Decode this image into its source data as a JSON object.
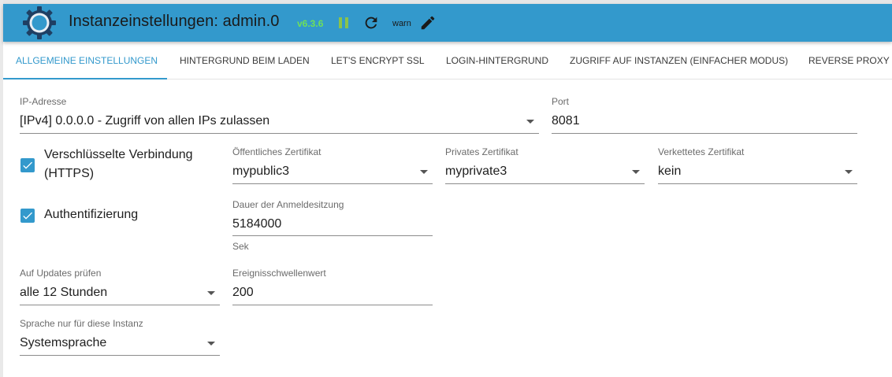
{
  "header": {
    "title": "Instanzeinstellungen: admin.0",
    "version": "v6.3.6",
    "loglevel": "warn"
  },
  "tabs": [
    {
      "label": "Allgemeine Einstellungen"
    },
    {
      "label": "Hintergrund beim Laden"
    },
    {
      "label": "Let's Encrypt SSL"
    },
    {
      "label": "Login-Hintergrund"
    },
    {
      "label": "Zugriff auf Instanzen (einfacher Modus)"
    },
    {
      "label": "Reverse Proxy"
    }
  ],
  "form": {
    "ip": {
      "label": "IP-Adresse",
      "value": "[IPv4] 0.0.0.0 - Zugriff von allen IPs zulassen"
    },
    "port": {
      "label": "Port",
      "value": "8081"
    },
    "https": {
      "label_line1": "Verschlüsselte Verbindung",
      "label_line2": "(HTTPS)",
      "checked": true
    },
    "public_cert": {
      "label": "Öffentliches Zertifikat",
      "value": "mypublic3"
    },
    "private_cert": {
      "label": "Privates Zertifikat",
      "value": "myprivate3"
    },
    "chained_cert": {
      "label": "Verkettetes Zertifikat",
      "value": "kein"
    },
    "auth": {
      "label": "Authentifizierung",
      "checked": true
    },
    "session": {
      "label": "Dauer der Anmeldesitzung",
      "value": "5184000",
      "helper": "Sek"
    },
    "updates": {
      "label": "Auf Updates prüfen",
      "value": "alle 12 Stunden"
    },
    "events": {
      "label": "Ereignisschwellenwert",
      "value": "200"
    },
    "language": {
      "label": "Sprache nur für diese Instanz",
      "value": "Systemsprache"
    }
  },
  "colors": {
    "accent": "#3399cc",
    "version": "#6ee05a",
    "pause": "#8bc34a"
  }
}
